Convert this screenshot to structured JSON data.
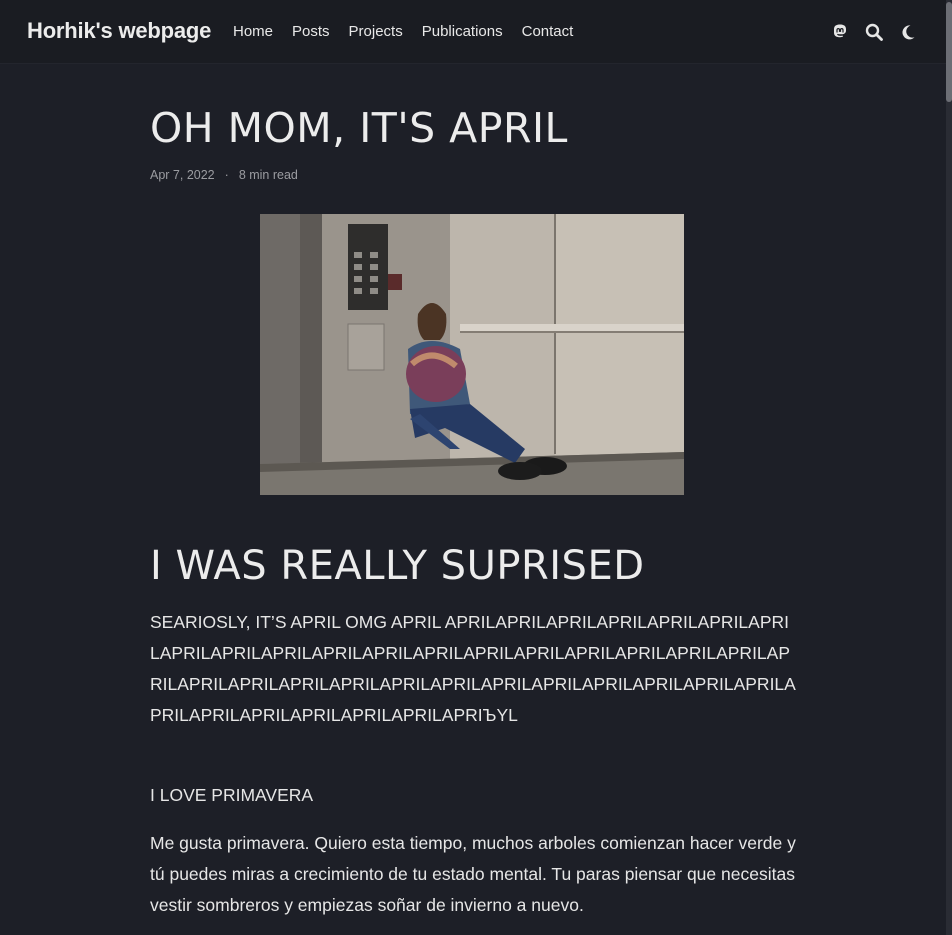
{
  "site": {
    "brand": "Horhik's webpage",
    "nav": [
      "Home",
      "Posts",
      "Projects",
      "Publications",
      "Contact"
    ],
    "icons": [
      "mastodon-icon",
      "search-icon",
      "moon-icon"
    ]
  },
  "post": {
    "title": "OH MOM, IT'S APRIL",
    "date": "Apr 7, 2022",
    "separator": "·",
    "read_time": "8 min read",
    "heading": "I WAS REALLY SUPRISED",
    "para1": "SEARIOSLY, IT’S APRIL OMG APRIL APRILAPRILAPRILAPRILAPRILAPRILAPRILAPRILAPRILAPRILAPRILAPRILAPRILAPRILAPRILAPRILAPRILAPRILAPRILAPRILAPRILAPRILAPRILAPRILAPRILAPRILAPRILAPRILAPRILAPRILAPRILAPRILAPRILAPRILAPRILAPRILAPRILAPRILAPRIЪYL",
    "para2": "I LOVE PRIMAVERA",
    "para3": "Me gusta primavera. Quiero esta tiempo, muchos arboles comienzan hacer verde y tú puedes miras a crecimiento de tu estado mental. Tu paras piensar que necesitas vestir sombreros y empiezas soñar de invierno a nuevo."
  },
  "colors": {
    "background": "#1d1f27",
    "navbar": "#1a1c22",
    "text": "#e4e4e6",
    "meta": "#9b9ca1"
  }
}
